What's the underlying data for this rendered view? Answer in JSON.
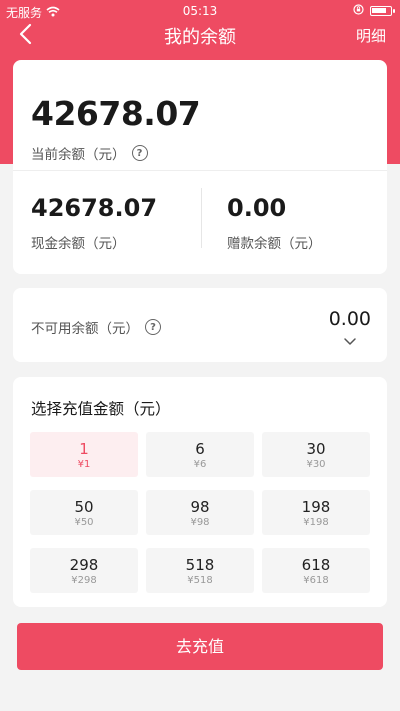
{
  "status_bar": {
    "carrier": "无服务",
    "time": "05:13"
  },
  "nav": {
    "title": "我的余额",
    "right_label": "明细"
  },
  "balance": {
    "current_amount": "42678.07",
    "current_label": "当前余额（元）",
    "cash_amount": "42678.07",
    "cash_label": "现金余额（元）",
    "gift_amount": "0.00",
    "gift_label": "赠款余额（元）"
  },
  "unavailable": {
    "label": "不可用余额（元）",
    "amount": "0.00"
  },
  "recharge": {
    "title": "选择充值金额（元）",
    "options": [
      {
        "amount": "1",
        "sub": "¥1",
        "selected": true
      },
      {
        "amount": "6",
        "sub": "¥6",
        "selected": false
      },
      {
        "amount": "30",
        "sub": "¥30",
        "selected": false
      },
      {
        "amount": "50",
        "sub": "¥50",
        "selected": false
      },
      {
        "amount": "98",
        "sub": "¥98",
        "selected": false
      },
      {
        "amount": "198",
        "sub": "¥198",
        "selected": false
      },
      {
        "amount": "298",
        "sub": "¥298",
        "selected": false
      },
      {
        "amount": "518",
        "sub": "¥518",
        "selected": false
      },
      {
        "amount": "618",
        "sub": "¥618",
        "selected": false
      }
    ],
    "button_label": "去充值"
  },
  "colors": {
    "accent": "#ee4b62",
    "background": "#f3f3f3",
    "selected_bg": "#fdeef0"
  }
}
